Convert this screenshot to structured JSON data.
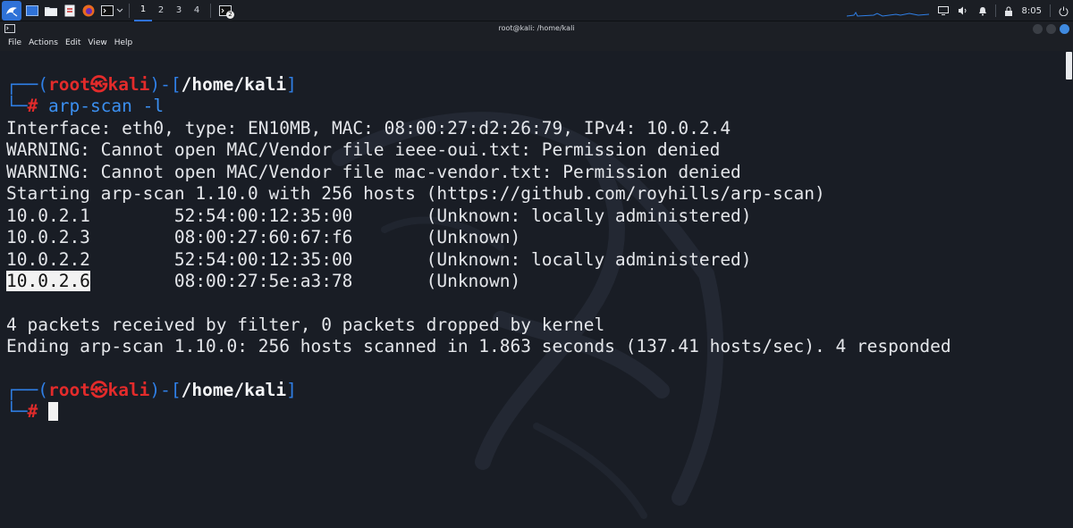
{
  "panel": {
    "workspaces": [
      "1",
      "2",
      "3",
      "4"
    ],
    "active_workspace": "1",
    "terminal_badge": "2",
    "clock": "8:05",
    "icons": [
      "kali-menu-icon",
      "show-desktop-icon",
      "file-manager-icon",
      "text-editor-icon",
      "firefox-icon",
      "terminal-icon",
      "chevron-down-icon",
      "terminal-task-icon",
      "display-icon",
      "volume-icon",
      "notification-bell-icon",
      "lock-icon",
      "power-icon"
    ]
  },
  "window": {
    "title": "root@kali: /home/kali"
  },
  "menubar": {
    "items": [
      "File",
      "Actions",
      "Edit",
      "View",
      "Help"
    ]
  },
  "terminal": {
    "prompt1": {
      "corner": "┌──(",
      "user": "root",
      "at_symbol": "㉿",
      "host": "kali",
      "mid": ")-[",
      "path": "/home/kali",
      "close": "]",
      "corner2": "└─",
      "hash": "#",
      "command": "arp-scan -l"
    },
    "output": [
      "Interface: eth0, type: EN10MB, MAC: 08:00:27:d2:26:79, IPv4: 10.0.2.4",
      "WARNING: Cannot open MAC/Vendor file ieee-oui.txt: Permission denied",
      "WARNING: Cannot open MAC/Vendor file mac-vendor.txt: Permission denied",
      "Starting arp-scan 1.10.0 with 256 hosts (https://github.com/royhills/arp-scan)",
      "10.0.2.1        52:54:00:12:35:00       (Unknown: locally administered)",
      "10.0.2.3        08:00:27:60:67:f6       (Unknown)",
      "10.0.2.2        52:54:00:12:35:00       (Unknown: locally administered)"
    ],
    "highlighted_ip": "10.0.2.6",
    "highlighted_rest": "        08:00:27:5e:a3:78       (Unknown)",
    "summary": [
      "4 packets received by filter, 0 packets dropped by kernel",
      "Ending arp-scan 1.10.0: 256 hosts scanned in 1.863 seconds (137.41 hosts/sec). 4 responded"
    ],
    "prompt2": {
      "corner": "┌──(",
      "user": "root",
      "at_symbol": "㉿",
      "host": "kali",
      "mid": ")-[",
      "path": "/home/kali",
      "close": "]",
      "corner2": "└─",
      "hash": "#"
    }
  },
  "colors": {
    "prompt_blue": "#2f7fe6",
    "prompt_red": "#e32b2b",
    "accent": "#2f72d8"
  }
}
